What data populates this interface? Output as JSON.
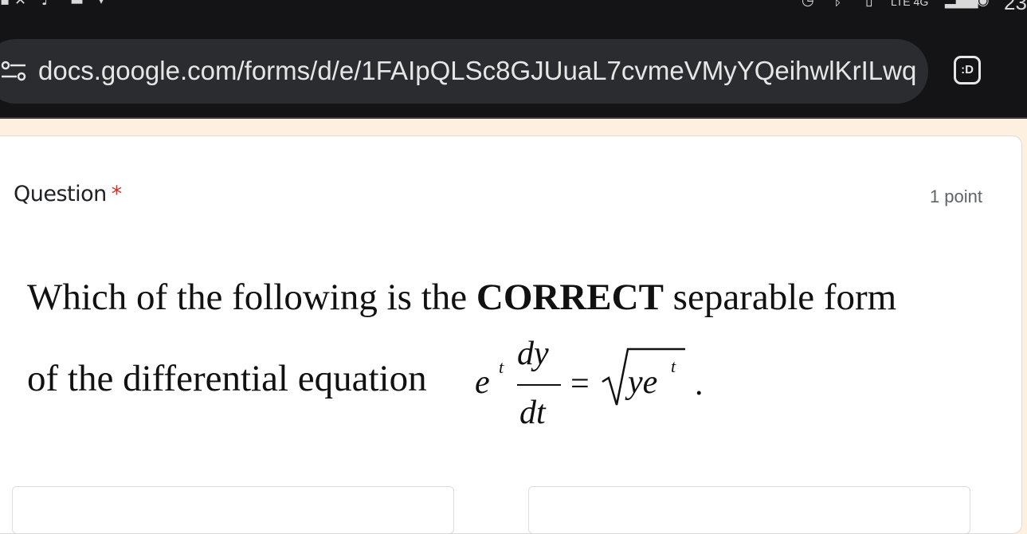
{
  "status_bar": {
    "network_label": "LTE 4G",
    "clock_partial": "23"
  },
  "browser": {
    "url": "docs.google.com/forms/d/e/1FAIpQLSc8GJUuaL7cvmeVMyYQeihwlKrILwq",
    "extension_label": ":D"
  },
  "question": {
    "title": "Question",
    "required_marker": "*",
    "points": "1 point",
    "line1_pre": "Which of the following is the ",
    "line1_bold": "CORRECT",
    "line1_post": " separable form",
    "line2": "of the differential equation",
    "math": {
      "e": "e",
      "t": "t",
      "dy": "dy",
      "dt": "dt",
      "equals": "=",
      "ye": "ye",
      "t2": "t",
      "period": "."
    }
  },
  "colors": {
    "toolbar_bg": "#141416",
    "urlbar_bg": "#2b2c30",
    "page_bg": "#fdf0de",
    "required": "#d93025"
  },
  "icons": [
    "site-info-icon",
    "extension-icon",
    "alarm-icon",
    "bluetooth-icon",
    "vibrate-icon",
    "signal-icon",
    "battery-icon"
  ]
}
